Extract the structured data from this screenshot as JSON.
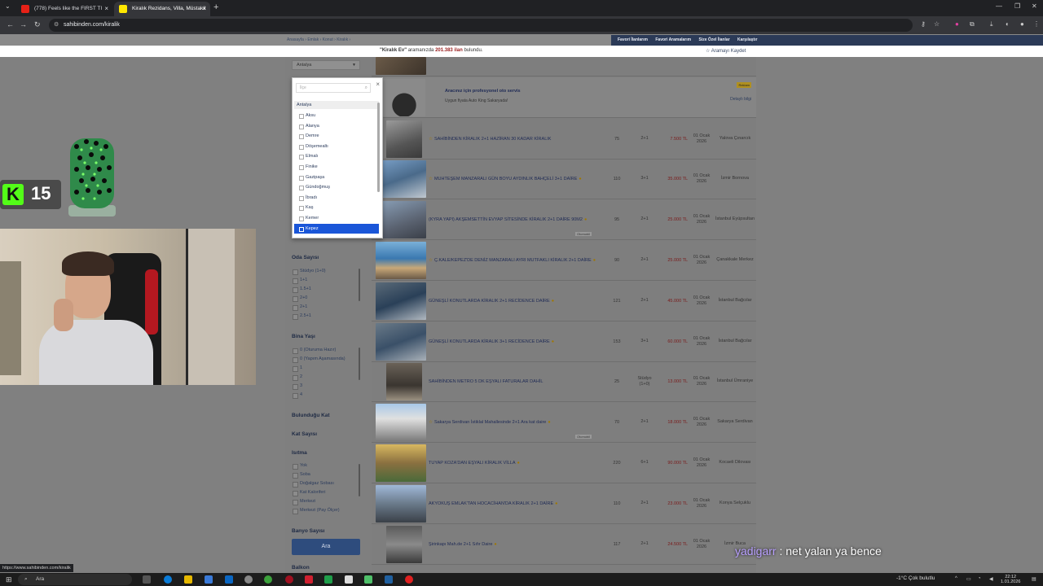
{
  "browser": {
    "tabs": [
      {
        "label": "(778) Feels like the FIRST TI"
      },
      {
        "label": "Kiralık Rezidans, Villa, Müstakil"
      }
    ],
    "url": "sahibinden.com/kiralik",
    "status_url": "https://www.sahibinden.com/kiralik"
  },
  "site": {
    "breadcrumb": [
      "Anasayfa",
      "Emlak",
      "Konut",
      "Kiralık"
    ],
    "top_links": [
      "Favori İlanlarım",
      "Favori Aramalarım",
      "Size Özel İlanlar",
      "Karşılaştır"
    ],
    "search_query": "\"Kiralık Ev\"",
    "search_mid": " aramanızda ",
    "result_count": "201.383 ilan",
    "search_suffix": " bulundu.",
    "save_search": "Aramayı Kaydet",
    "city_select": "Antalya"
  },
  "dropdown": {
    "search_placeholder": "İlçe",
    "group": "Antalya",
    "items": [
      "Aksu",
      "Alanya",
      "Demre",
      "Döşemealtı",
      "Elmalı",
      "Finike",
      "Gazipaşa",
      "Gündoğmuş",
      "İbradı",
      "Kaş",
      "Kemer",
      "Kepez"
    ],
    "selected": "Kepez"
  },
  "filters": {
    "oda_sayisi": {
      "title": "Oda Sayısı",
      "options": [
        "Stüdyo (1+0)",
        "1+1",
        "1.5+1",
        "2+0",
        "2+1",
        "2.5+1"
      ]
    },
    "bina_yasi": {
      "title": "Bina Yaşı",
      "options": [
        "0 (Oturuma Hazır)",
        "0 (Yapım Aşamasında)",
        "1",
        "2",
        "3",
        "4"
      ]
    },
    "bulundugu_kat": {
      "title": "Bulunduğu Kat"
    },
    "kat_sayisi": {
      "title": "Kat Sayısı"
    },
    "isitma": {
      "title": "Isıtma",
      "options": [
        "Yok",
        "Soba",
        "Doğalgaz Sobası",
        "Kat Kaloriferi",
        "Merkezi",
        "Merkezi (Pay Ölçer)"
      ]
    },
    "banyo_sayisi": {
      "title": "Banyo Sayısı"
    },
    "balkon": {
      "title": "Balkon"
    },
    "search_button": "Ara"
  },
  "ad": {
    "title": "Aracınız için profesyonel oto servis",
    "subtitle": "Uygun fiyata Auto King Sakaryada!",
    "badge": "Reklam",
    "link": "Detaylı bilgi"
  },
  "listings": [
    {
      "title": "SAHİBİNDEN KİRALIK 2+1 HAZİRAN 30 KADAR KİRALIK",
      "m2": "75",
      "oda": "2+1",
      "fiyat": "7.500 TL",
      "tarih": "01 Ocak 2026",
      "il": "Yalova Çınarcık",
      "star": true,
      "dot": false
    },
    {
      "title": "MUHTEŞEM MANZARALI GÜN BOYU AYDINLIK BAHÇELİ 3+1 DAİRE",
      "m2": "110",
      "oda": "3+1",
      "fiyat": "35.000 TL",
      "tarih": "01 Ocak 2026",
      "il": "İzmir Bornova",
      "star": true,
      "dot": true
    },
    {
      "title": "(KYRA YAPI) AKŞEMSETTİN EVYAP SİTESİNDE KİRALIK 2+1 DAİRE 90M2",
      "m2": "95",
      "oda": "2+1",
      "fiyat": "25.000 TL",
      "tarih": "01 Ocak 2026",
      "il": "İstanbul Eyüpsultan",
      "star": false,
      "dot": true,
      "tag": "Otomobil"
    },
    {
      "title": "Ç.KALE/KEPEZ'DE DENİZ MANZARALI AYRI MUTFAKLI KİRALIK 2+1 DAİRE",
      "m2": "90",
      "oda": "2+1",
      "fiyat": "25.000 TL",
      "tarih": "01 Ocak 2026",
      "il": "Çanakkale Merkez",
      "star": true,
      "dot": true
    },
    {
      "title": "GÜNEŞLİ KONUTLARDA KİRALIK 2+1 RECİDENCE DAİRE",
      "m2": "121",
      "oda": "2+1",
      "fiyat": "45.000 TL",
      "tarih": "01 Ocak 2026",
      "il": "İstanbul Bağcılar",
      "star": false,
      "dot": true
    },
    {
      "title": "GÜNEŞLİ KONUTLARDA KİRALIK 3+1 RECİDENCE DAİRE",
      "m2": "153",
      "oda": "3+1",
      "fiyat": "60.000 TL",
      "tarih": "01 Ocak 2026",
      "il": "İstanbul Bağcılar",
      "star": false,
      "dot": true
    },
    {
      "title": "SAHİBİNDEN METRO 5 DK EŞYALI FATURALAR DAHİL",
      "m2": "25",
      "oda": "Stüdyo (1+0)",
      "fiyat": "13.000 TL",
      "tarih": "01 Ocak 2026",
      "il": "İstanbul Ümraniye",
      "star": false,
      "dot": false
    },
    {
      "title": "Sakarya Serdivan İstiklal Mahallesinde 2+1 Ara kat daire",
      "m2": "70",
      "oda": "2+1",
      "fiyat": "18.000 TL",
      "tarih": "01 Ocak 2026",
      "il": "Sakarya Serdivan",
      "star": true,
      "dot": true,
      "tag": "Otomobil"
    },
    {
      "title": "TUYAP KOZA'DAN EŞYALI KİRALIK VİLLA",
      "m2": "220",
      "oda": "6+1",
      "fiyat": "90.000 TL",
      "tarih": "01 Ocak 2026",
      "il": "Kocaeli Dilovası",
      "star": false,
      "dot": true
    },
    {
      "title": "AKYOKUŞ EMLAK'TAN HOCACİHAN'DA KİRALIK 2+1 DAİRE",
      "m2": "110",
      "oda": "2+1",
      "fiyat": "23.000 TL",
      "tarih": "01 Ocak 2026",
      "il": "Konya Selçuklu",
      "star": false,
      "dot": true
    },
    {
      "title": "Şirinkapı Mah.de 2+1 Sıfır Daire",
      "m2": "117",
      "oda": "2+1",
      "fiyat": "24.500 TL",
      "tarih": "01 Ocak 2026",
      "il": "İzmir Buca",
      "star": false,
      "dot": true
    }
  ],
  "overlay": {
    "kick_count": "15",
    "chat_user": "yadigarr",
    "chat_sep": " : ",
    "chat_message": "net yalan ya bence"
  },
  "taskbar": {
    "search_label": "Ara",
    "weather": "-1°C  Çok bulutlu",
    "time": "22:12",
    "date": "1.01.2026"
  },
  "colors": {
    "kick_green": "#53fc18",
    "selected_item": "#1a56d8",
    "site_nav": "#2b3a57",
    "price_red": "#7a1a1a"
  }
}
